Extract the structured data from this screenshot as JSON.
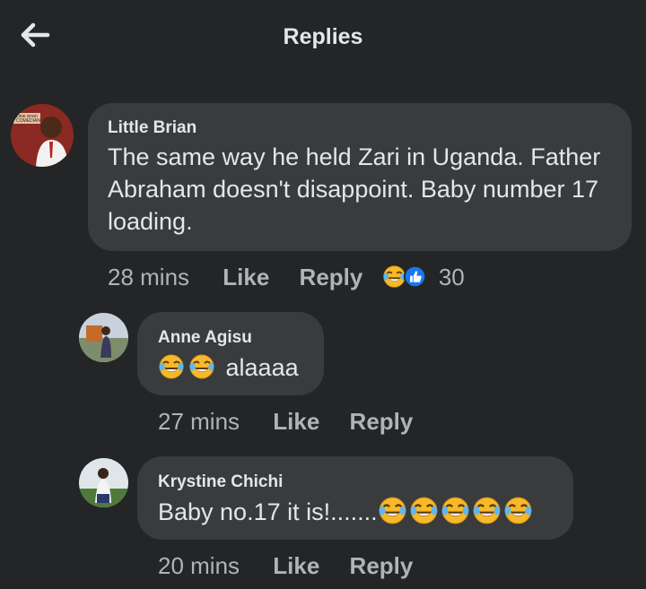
{
  "header": {
    "title": "Replies"
  },
  "comment": {
    "author": "Little Brian",
    "avatar_caption": "Little Brian COMEDIAN",
    "text": "The same way he held Zari in Uganda. Father Abraham doesn't disappoint. Baby number 17 loading.",
    "time": "28 mins",
    "like_label": "Like",
    "reply_label": "Reply",
    "reaction_count": "30",
    "reaction_icons": [
      "haha-reaction-icon",
      "like-reaction-icon"
    ]
  },
  "replies": [
    {
      "author": "Anne Agisu",
      "text": "alaaaa",
      "emoji_prefix_count": 2,
      "time": "27 mins",
      "like_label": "Like",
      "reply_label": "Reply"
    },
    {
      "author": "Krystine Chichi",
      "text": "Baby no.17  it is!.......",
      "emoji_suffix_count": 5,
      "time": "20 mins",
      "like_label": "Like",
      "reply_label": "Reply"
    }
  ],
  "colors": {
    "background": "#242526",
    "bubble": "#3a3b3c",
    "text": "#e4e6eb",
    "meta": "#b0b3b8",
    "emoji": "#f7b928",
    "like_blue": "#1877f2"
  }
}
